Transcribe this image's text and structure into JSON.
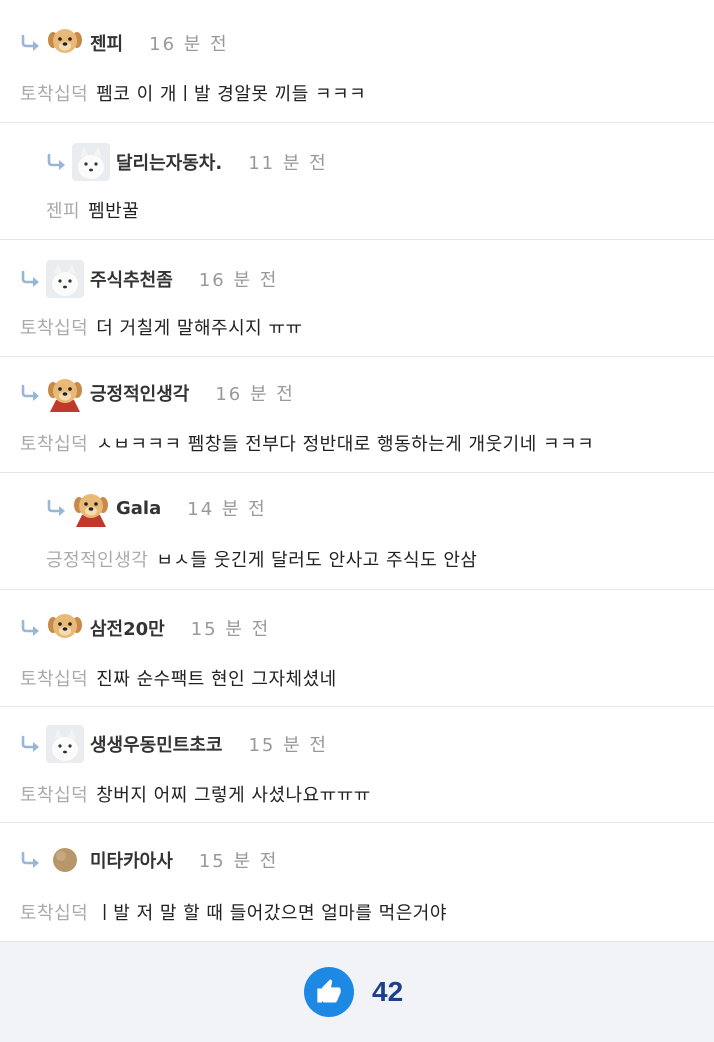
{
  "comments": [
    {
      "avatar": "puppy-avatar",
      "username": "젠피",
      "time": "16 분 전",
      "mention": "토착십덕",
      "text": "펨코 이 개ㅣ발 경알못  끼들 ㅋㅋㅋ"
    },
    {
      "avatar": "white-dog-avatar",
      "username": "달리는자동차.",
      "time": "11 분 전",
      "mention": "젠피",
      "text": "펨반꿀"
    },
    {
      "avatar": "white-dog-avatar",
      "username": "주식추천좀",
      "time": "16 분 전",
      "mention": "토착십덕",
      "text": "더 거칠게 말해주시지 ㅠㅠ"
    },
    {
      "avatar": "puppy-cape-avatar",
      "username": "긍정적인생각",
      "time": "16 분 전",
      "mention": "토착십덕",
      "text": "ㅅㅂㅋㅋㅋ 펨창들 전부다 정반대로 행동하는게 개웃기네 ㅋㅋㅋ"
    },
    {
      "avatar": "puppy-cape-avatar",
      "username": "Gala",
      "time": "14 분 전",
      "mention": "긍정적인생각",
      "text": "ㅂㅅ들 웃긴게 달러도 안사고 주식도 안삼"
    },
    {
      "avatar": "puppy-avatar",
      "username": "삼전20만",
      "time": "15 분 전",
      "mention": "토착십덕",
      "text": "진짜 순수팩트 현인 그자체셨네"
    },
    {
      "avatar": "white-dog-avatar",
      "username": "생생우동민트초코",
      "time": "15 분 전",
      "mention": "토착십덕",
      "text": "창버지 어찌 그렇게 사셨나요ㅠㅠㅠ"
    },
    {
      "avatar": "round-avatar",
      "username": "미타카아사",
      "time": "15 분 전",
      "mention": "토착십덕",
      "text": "ㅣ발 저 말 할 때 들어갔으면 얼마를 먹은거야"
    }
  ],
  "likes": {
    "icon": "thumbs-up-icon",
    "count": "42"
  },
  "colors": {
    "like_blue": "#1e88e5",
    "count_navy": "#1c3f8c",
    "mention_gray": "#aaaaaa"
  }
}
